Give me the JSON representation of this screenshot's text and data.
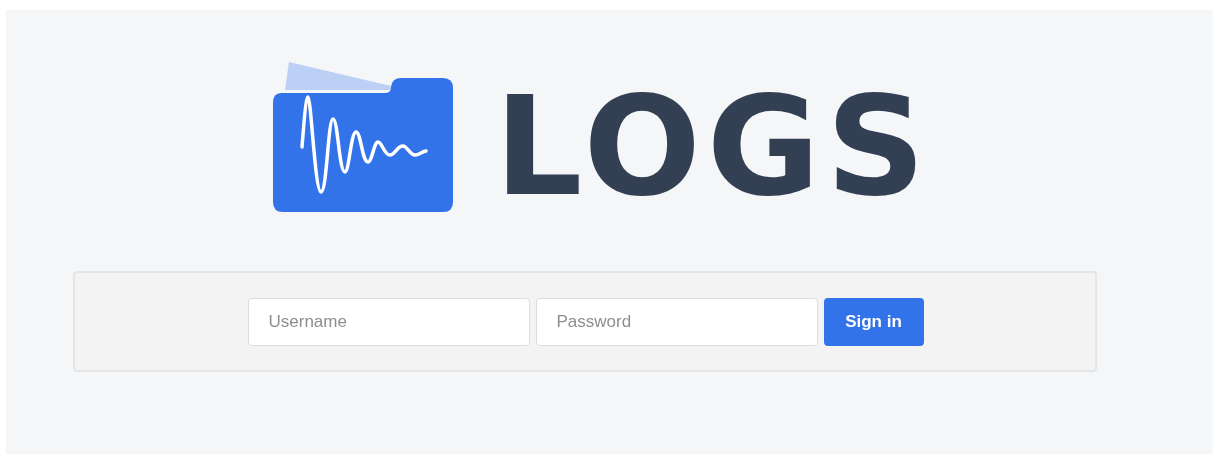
{
  "logo": {
    "text": "LOGS"
  },
  "login_form": {
    "username": {
      "placeholder": "Username"
    },
    "password": {
      "placeholder": "Password"
    },
    "submit": {
      "label": "Sign in"
    }
  }
}
